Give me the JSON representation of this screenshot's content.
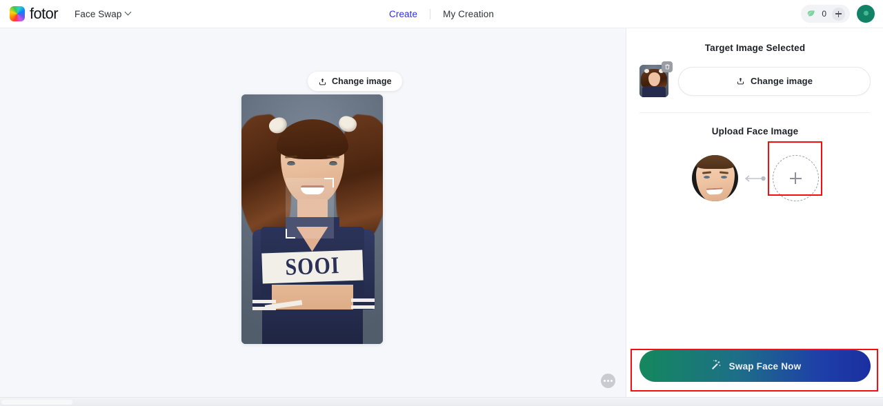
{
  "topbar": {
    "logo_icon": "fotor-color-wheel-icon",
    "brand": "fotor",
    "tool_dropdown": {
      "label": "Face Swap",
      "icon": "chevron-down-icon"
    },
    "nav": [
      {
        "label": "Create",
        "active": true
      },
      {
        "label": "My Creation",
        "active": false
      }
    ],
    "credits": {
      "icon": "leaf-icon",
      "value": "0"
    },
    "add_credits_icon": "plus-icon",
    "avatar": {
      "icon": "user-avatar-icon",
      "color": "#128266"
    },
    "accent_color": "#2c2cf0"
  },
  "canvas": {
    "change_image_button": {
      "label": "Change image",
      "icon": "upload-icon"
    },
    "preview": {
      "alt": "cheerleader-portrait",
      "uniform_text": "SOOI",
      "face_selection_box": "face-detection-box"
    },
    "more_button_icon": "ellipsis-icon"
  },
  "panel": {
    "target_section": {
      "title": "Target Image Selected",
      "thumbnail_alt": "target-image-thumbnail",
      "delete_icon": "trash-icon",
      "change_button": {
        "label": "Change image",
        "icon": "upload-icon"
      }
    },
    "upload_face_section": {
      "title": "Upload Face Image",
      "detected_face_alt": "detected-face-thumbnail",
      "connector_icon": "arrow-left-icon",
      "upload_slot_icon": "plus-icon"
    },
    "swap_button": {
      "label": "Swap Face Now",
      "icon": "magic-wand-icon"
    }
  },
  "highlights": {
    "color": "#f60d0d",
    "targets": [
      "upload-face-slot",
      "swap-face-now-button"
    ]
  }
}
